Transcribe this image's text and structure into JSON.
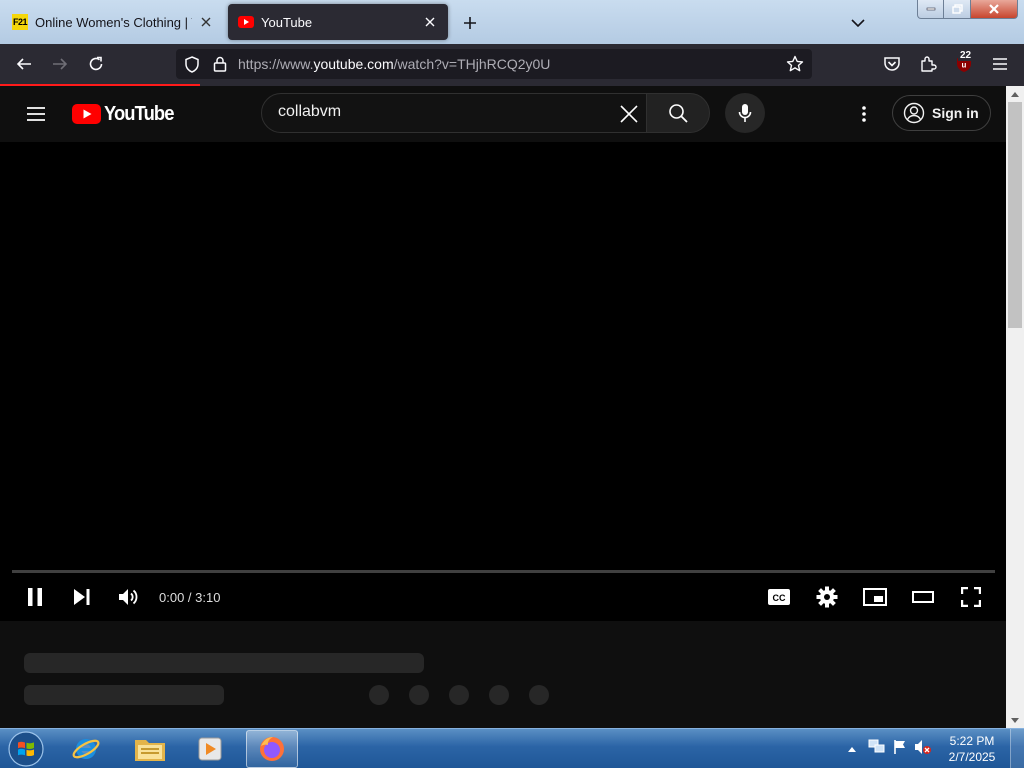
{
  "browser": {
    "tabs": [
      {
        "label": "Online Women's Clothing | Tren",
        "favicon": "F21",
        "active": false
      },
      {
        "label": "YouTube",
        "favicon": "youtube-icon",
        "active": true
      }
    ],
    "url": {
      "scheme": "https://www.",
      "domain": "youtube.com",
      "path": "/watch?v=THjhRCQ2y0U"
    },
    "extension_badge": "22",
    "loading_progress": 0.195
  },
  "youtube": {
    "logo_text": "YouTube",
    "search": {
      "value": "collabvm"
    },
    "sign_in_label": "Sign in",
    "player": {
      "time_display": "0:00 / 3:10",
      "state": "playing",
      "played_fraction": 0
    }
  },
  "taskbar": {
    "clock": {
      "time": "5:22 PM",
      "date": "2/7/2025"
    }
  },
  "colors": {
    "browser_chrome": "#2b2a33",
    "youtube_red": "#ff0000",
    "page_background": "#0f0f0f",
    "taskbar": "#2b64a6"
  }
}
